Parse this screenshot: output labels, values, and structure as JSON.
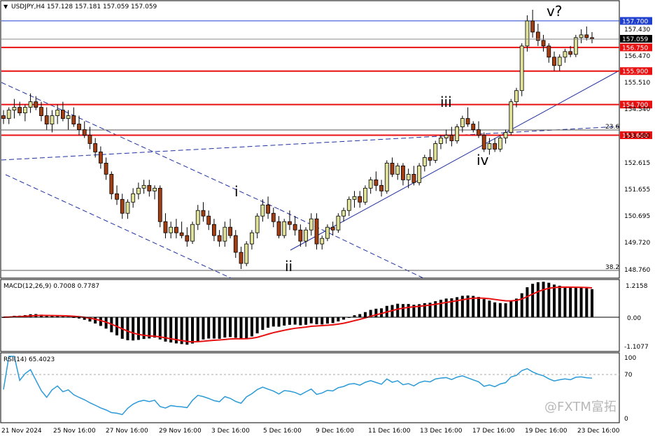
{
  "chart_data": [
    {
      "type": "candlestick",
      "title": "USDJPY,H4  157.128 157.181 157.059 157.059",
      "symbol": "USDJPY",
      "timeframe": "H4",
      "ohlc_header": {
        "open": 157.128,
        "high": 157.181,
        "low": 157.059,
        "close": 157.059
      },
      "current_price": 157.059,
      "ylim": [
        148.5,
        158.4
      ],
      "y_ticks": [
        "157.430",
        "156.470",
        "155.510",
        "154.540",
        "153.580",
        "152.615",
        "151.655",
        "150.695",
        "149.720",
        "148.760"
      ],
      "x_ticks": [
        "21 Nov 2024",
        "25 Nov 16:00",
        "27 Nov 16:00",
        "29 Nov 16:00",
        "3 Dec 16:00",
        "5 Dec 16:00",
        "9 Dec 16:00",
        "11 Dec 16:00",
        "13 Dec 16:00",
        "17 Dec 16:00",
        "19 Dec 16:00",
        "23 Dec 16:00"
      ],
      "price_levels": [
        {
          "value": 157.7,
          "label": "157.700",
          "color": "#1f3fcf"
        },
        {
          "value": 156.75,
          "label": "156.750",
          "color": "#e81010"
        },
        {
          "value": 155.9,
          "label": "155.900",
          "color": "#e81010"
        },
        {
          "value": 154.7,
          "label": "154.700",
          "color": "#e81010"
        },
        {
          "value": 153.6,
          "label": "153.600",
          "color": "#e81010"
        }
      ],
      "fib_labels": [
        "23.6",
        "38.2"
      ],
      "wave_labels": [
        "i",
        "ii",
        "iii",
        "iv",
        "v?"
      ],
      "candles": [
        [
          154.3,
          154.5,
          154.0,
          154.2
        ],
        [
          154.2,
          154.6,
          154.0,
          154.5
        ],
        [
          154.5,
          154.9,
          154.2,
          154.6
        ],
        [
          154.6,
          154.8,
          154.3,
          154.4
        ],
        [
          154.4,
          154.7,
          154.1,
          154.6
        ],
        [
          154.6,
          155.1,
          154.4,
          154.8
        ],
        [
          154.8,
          155.0,
          154.5,
          154.6
        ],
        [
          154.6,
          154.8,
          154.1,
          154.3
        ],
        [
          154.3,
          154.6,
          153.8,
          154.0
        ],
        [
          154.0,
          154.5,
          153.7,
          154.3
        ],
        [
          154.3,
          154.7,
          154.0,
          154.5
        ],
        [
          154.5,
          154.8,
          154.1,
          154.2
        ],
        [
          154.2,
          154.5,
          153.8,
          154.3
        ],
        [
          154.3,
          154.6,
          153.9,
          154.0
        ],
        [
          154.0,
          154.3,
          153.6,
          153.8
        ],
        [
          153.8,
          154.1,
          153.5,
          153.6
        ],
        [
          153.6,
          153.9,
          153.1,
          153.3
        ],
        [
          153.3,
          153.5,
          152.8,
          153.0
        ],
        [
          153.0,
          153.2,
          152.4,
          152.6
        ],
        [
          152.6,
          152.8,
          152.0,
          152.2
        ],
        [
          152.2,
          152.3,
          151.3,
          151.5
        ],
        [
          151.5,
          151.8,
          151.1,
          151.3
        ],
        [
          151.3,
          151.5,
          150.6,
          150.8
        ],
        [
          150.8,
          151.3,
          150.6,
          151.2
        ],
        [
          151.2,
          151.7,
          151.0,
          151.5
        ],
        [
          151.5,
          151.9,
          151.3,
          151.7
        ],
        [
          151.7,
          152.0,
          151.5,
          151.8
        ],
        [
          151.8,
          152.0,
          151.4,
          151.6
        ],
        [
          151.6,
          151.8,
          151.3,
          151.7
        ],
        [
          151.7,
          151.8,
          150.3,
          150.5
        ],
        [
          150.5,
          150.8,
          149.9,
          150.1
        ],
        [
          150.1,
          150.5,
          149.9,
          150.3
        ],
        [
          150.3,
          150.6,
          149.9,
          150.1
        ],
        [
          150.1,
          150.5,
          149.9,
          150.0
        ],
        [
          150.0,
          150.3,
          149.6,
          149.8
        ],
        [
          149.8,
          150.5,
          149.7,
          150.4
        ],
        [
          150.4,
          151.1,
          150.2,
          150.9
        ],
        [
          150.9,
          151.2,
          150.5,
          150.7
        ],
        [
          150.7,
          150.9,
          150.2,
          150.4
        ],
        [
          150.4,
          150.6,
          149.8,
          150.0
        ],
        [
          150.0,
          150.2,
          149.6,
          149.8
        ],
        [
          149.8,
          150.5,
          149.6,
          150.3
        ],
        [
          150.3,
          150.6,
          149.9,
          150.0
        ],
        [
          150.0,
          150.2,
          149.2,
          149.4
        ],
        [
          149.4,
          149.6,
          148.8,
          149.0
        ],
        [
          149.0,
          149.8,
          148.9,
          149.7
        ],
        [
          149.7,
          150.2,
          149.5,
          150.1
        ],
        [
          150.1,
          150.8,
          149.9,
          150.7
        ],
        [
          150.7,
          151.3,
          150.5,
          151.1
        ],
        [
          151.1,
          151.4,
          150.6,
          150.8
        ],
        [
          150.8,
          151.0,
          150.3,
          150.5
        ],
        [
          150.5,
          150.7,
          149.9,
          150.0
        ],
        [
          150.0,
          150.6,
          149.9,
          150.5
        ],
        [
          150.5,
          150.9,
          150.2,
          150.4
        ],
        [
          150.4,
          150.7,
          150.0,
          150.2
        ],
        [
          150.2,
          150.4,
          149.6,
          149.8
        ],
        [
          149.8,
          150.3,
          149.6,
          150.2
        ],
        [
          150.2,
          150.8,
          150.0,
          150.6
        ],
        [
          150.6,
          150.8,
          149.5,
          149.7
        ],
        [
          149.7,
          150.0,
          149.5,
          149.9
        ],
        [
          149.9,
          150.4,
          149.8,
          150.3
        ],
        [
          150.3,
          150.5,
          150.0,
          150.2
        ],
        [
          150.2,
          150.8,
          150.1,
          150.7
        ],
        [
          150.7,
          151.0,
          150.5,
          150.9
        ],
        [
          150.9,
          151.4,
          150.7,
          151.3
        ],
        [
          151.3,
          151.6,
          151.0,
          151.4
        ],
        [
          151.4,
          151.6,
          151.0,
          151.2
        ],
        [
          151.2,
          151.8,
          151.1,
          151.7
        ],
        [
          151.7,
          152.1,
          151.5,
          152.0
        ],
        [
          152.0,
          152.3,
          151.6,
          151.8
        ],
        [
          151.8,
          152.0,
          151.4,
          151.6
        ],
        [
          151.6,
          152.7,
          151.5,
          152.6
        ],
        [
          152.6,
          152.8,
          152.1,
          152.2
        ],
        [
          152.2,
          152.6,
          152.0,
          152.5
        ],
        [
          152.5,
          152.6,
          151.8,
          152.0
        ],
        [
          152.0,
          152.4,
          151.7,
          152.2
        ],
        [
          152.2,
          152.5,
          151.8,
          151.9
        ],
        [
          151.9,
          152.6,
          151.8,
          152.5
        ],
        [
          152.5,
          152.9,
          152.3,
          152.8
        ],
        [
          152.8,
          153.1,
          152.5,
          152.7
        ],
        [
          152.7,
          153.4,
          152.6,
          153.3
        ],
        [
          153.3,
          153.6,
          153.1,
          153.5
        ],
        [
          153.5,
          153.8,
          153.3,
          153.6
        ],
        [
          153.6,
          153.9,
          153.2,
          153.4
        ],
        [
          153.4,
          154.0,
          153.3,
          153.9
        ],
        [
          153.9,
          154.3,
          153.7,
          154.2
        ],
        [
          154.2,
          154.6,
          153.9,
          154.0
        ],
        [
          154.0,
          154.1,
          153.7,
          153.8
        ],
        [
          153.8,
          154.1,
          153.5,
          153.6
        ],
        [
          153.6,
          153.7,
          153.0,
          153.1
        ],
        [
          153.1,
          153.5,
          152.9,
          153.3
        ],
        [
          153.3,
          153.5,
          153.0,
          153.1
        ],
        [
          153.1,
          153.6,
          153.0,
          153.5
        ],
        [
          153.5,
          153.8,
          153.3,
          153.7
        ],
        [
          153.7,
          154.9,
          153.6,
          154.8
        ],
        [
          154.8,
          155.3,
          154.6,
          155.2
        ],
        [
          155.2,
          156.9,
          155.0,
          156.8
        ],
        [
          156.8,
          157.9,
          156.6,
          157.7
        ],
        [
          157.7,
          158.1,
          157.1,
          157.3
        ],
        [
          157.3,
          157.6,
          156.8,
          157.0
        ],
        [
          157.0,
          157.2,
          156.6,
          156.8
        ],
        [
          156.8,
          156.9,
          156.2,
          156.4
        ],
        [
          156.4,
          156.6,
          155.9,
          156.1
        ],
        [
          156.1,
          156.5,
          155.9,
          156.4
        ],
        [
          156.4,
          156.7,
          156.2,
          156.6
        ],
        [
          156.6,
          156.8,
          156.4,
          156.5
        ],
        [
          156.5,
          157.2,
          156.4,
          157.1
        ],
        [
          157.1,
          157.4,
          156.9,
          157.2
        ],
        [
          157.2,
          157.5,
          157.0,
          157.1
        ],
        [
          157.1,
          157.3,
          156.9,
          157.059
        ]
      ],
      "series": [
        {
          "name": "MACD(12,26,9) 0.7008 0.7787",
          "ylim": [
            -1.1077,
            1.2158
          ],
          "y_ticks": [
            "1.2158",
            "0.00",
            "-1.1077"
          ]
        },
        {
          "name": "RSI(14) 65.4023",
          "ylim": [
            0,
            100
          ],
          "y_ticks": [
            "100",
            "70",
            "0"
          ]
        }
      ]
    }
  ],
  "colors": {
    "bull": "#e0e29a",
    "bear": "#a23e12",
    "support": "#e81010",
    "resistance_blue": "#1f3fcf",
    "trend": "#2030a0",
    "signal": "#e81010",
    "rsi": "#2a9ad8"
  },
  "watermark": "@FXTM富拓"
}
